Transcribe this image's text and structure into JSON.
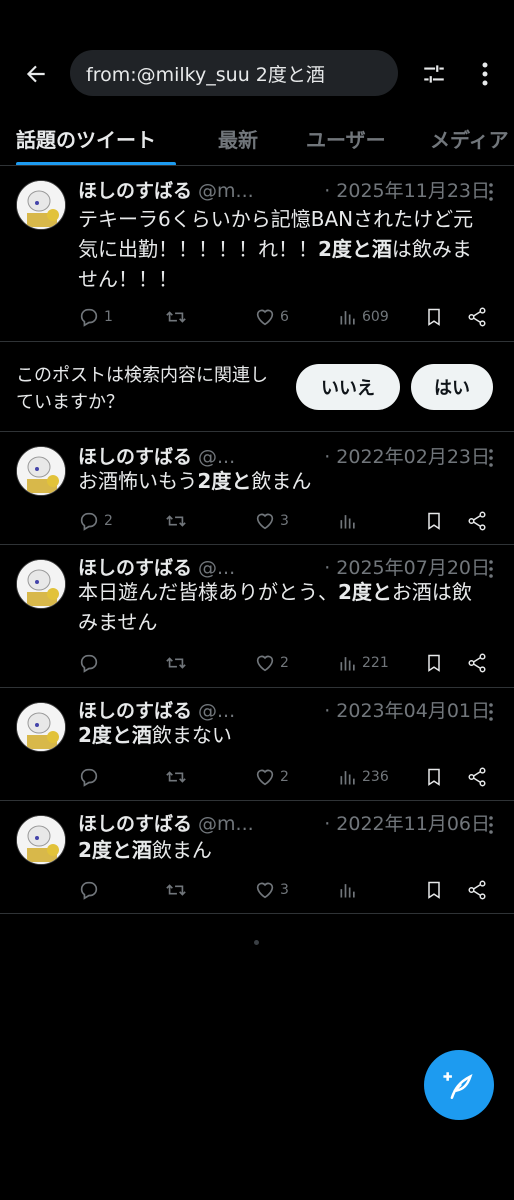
{
  "search": {
    "query": "from:@milky_suu 2度と酒"
  },
  "tabs": [
    {
      "label": "話題のツイート"
    },
    {
      "label": "最新"
    },
    {
      "label": "ユーザー"
    },
    {
      "label": "メディア"
    }
  ],
  "relevance": {
    "question": "このポストは検索内容に関連していますか？",
    "no_label": "いいえ",
    "yes_label": "はい"
  },
  "tweets": [
    {
      "name": "ほしのすばる",
      "handle": "@m...",
      "date": "· 2025年11月23日",
      "text_parts": [
        "テキーラ6くらいから記憶BANされたけど元気に出勤！！！！！れ！！",
        "2度と酒",
        "は飲みません！！！"
      ],
      "replies": "1",
      "retweets": "",
      "likes": "6",
      "views": "609"
    },
    {
      "name": "ほしのすばる",
      "handle": "@...",
      "date": "· 2022年02月23日",
      "text_parts": [
        "お酒怖いもう",
        "2度と",
        "飲まん"
      ],
      "replies": "2",
      "retweets": "",
      "likes": "3",
      "views": ""
    },
    {
      "name": "ほしのすばる",
      "handle": "@...",
      "date": "· 2025年07月20日",
      "text_parts": [
        "本日遊んだ皆様ありがとう、",
        "2度と",
        "お酒は飲みません"
      ],
      "replies": "",
      "retweets": "",
      "likes": "2",
      "views": "221"
    },
    {
      "name": "ほしのすばる",
      "handle": "@...",
      "date": "· 2023年04月01日",
      "text_parts": [
        "",
        "2度と酒",
        "飲まない"
      ],
      "replies": "",
      "retweets": "",
      "likes": "2",
      "views": "236"
    },
    {
      "name": "ほしのすばる",
      "handle": "@m...",
      "date": "· 2022年11月06日",
      "text_parts": [
        "",
        "2度と酒",
        "飲まん"
      ],
      "replies": "",
      "retweets": "",
      "likes": "3",
      "views": ""
    }
  ],
  "colors": {
    "accent": "#1d9bf0",
    "background": "#000000",
    "muted": "#71767b"
  }
}
